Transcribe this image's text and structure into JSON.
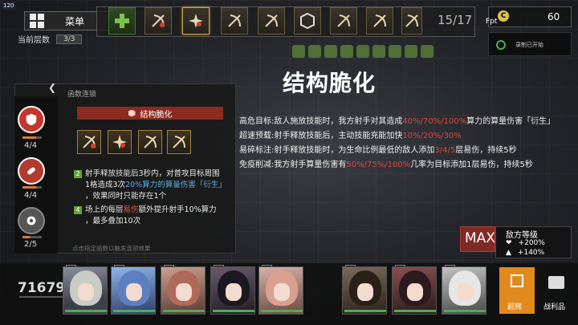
{
  "fps": "120",
  "menu": {
    "label": "菜单",
    "floor_label": "当前层数",
    "floor_count": "3/3"
  },
  "topbar": {
    "count": "15/17"
  },
  "currency": {
    "value": "60",
    "icon": "C"
  },
  "recording": {
    "label": "录制已开始",
    "fps_icon": "Fpt"
  },
  "panel": {
    "header": "函数连锁",
    "skill_button": "结构脆化",
    "stack1": "4/4",
    "stack2": "4/4",
    "stack3": "2/5",
    "line1_num": "2",
    "line1a": "射手释放技能后3秒内，对普攻目标周围",
    "line1b_pre": "1格造成3次",
    "line1b_hl": "20%算力的算量伤害「衍生」",
    "line1c": "，效果同时只能存在1个",
    "line2_num": "4",
    "line2a_pre": "场上的每层",
    "line2a_hl": "易伤",
    "line2a_post": "额外提升射手10%算力",
    "line2b": "，最多叠加10次",
    "footnote": "点击指定函数以触发连锁效果"
  },
  "main": {
    "title": "结构脆化",
    "d1_pre": "高危目标:敌人施放技能时，我方射手对其造成",
    "d1_hl": "40%/70%/100%",
    "d1_post": "算力的算量伤害「衍生」",
    "d2_pre": "超速预载:射手释放技能后，主动技能充能加快",
    "d2_hl": "10%/20%/30%",
    "d3_pre": "易碎标注:射手释放技能时，为生命比例最低的敌人添加",
    "d3_hl": "3/4/5",
    "d3_post": "层易伤，持续5秒",
    "d4_pre": "免疫削减:我方射手算量伤害有",
    "d4_hl": "50%/75%/100%",
    "d4_post": "几率为目标添加1层易伤，持续5秒"
  },
  "enemy": {
    "max": "MAX",
    "title": "敌方等级",
    "hp_bonus": "+200%",
    "atk_bonus": "+140%"
  },
  "bottom": {
    "score": "71679",
    "overclock": "超频",
    "loot": "战利品"
  },
  "colors": {
    "accent_red": "#e0463c",
    "overclock_orange": "#e08a1e",
    "hp_green": "#4caf50"
  }
}
